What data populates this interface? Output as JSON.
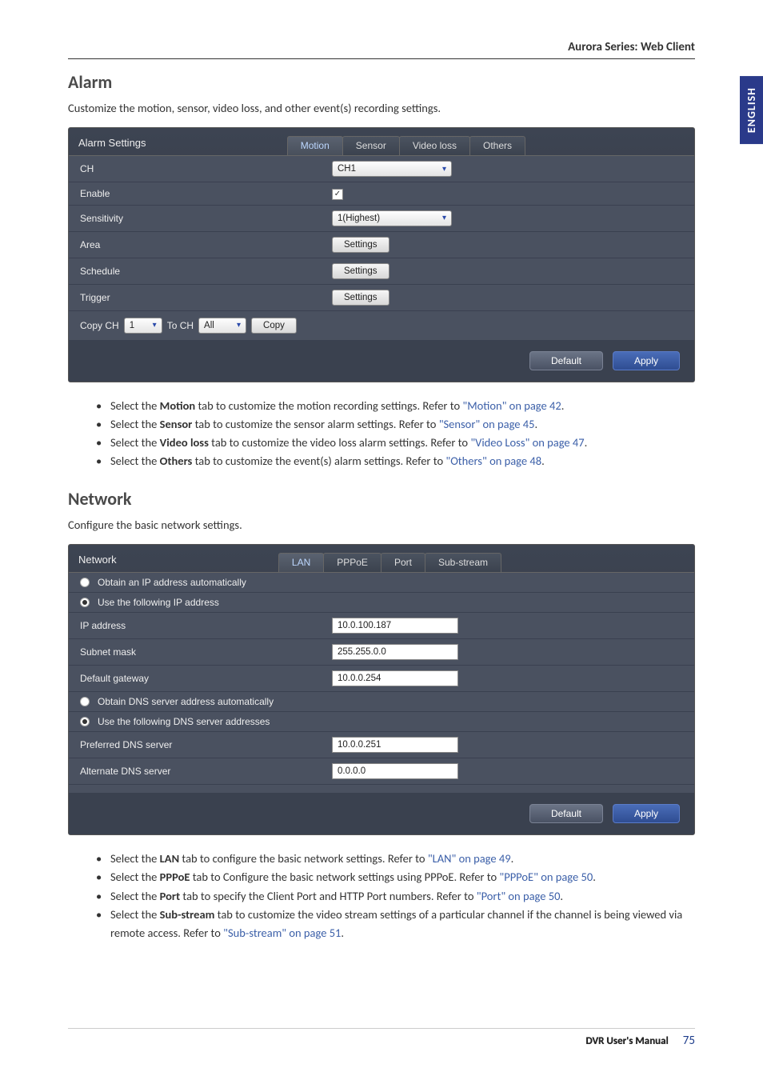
{
  "header": {
    "title": "Aurora Series: Web Client"
  },
  "side_tab": "ENGLISH",
  "alarm": {
    "heading": "Alarm",
    "intro": "Customize the motion, sensor, video loss, and other event(s) recording settings.",
    "panel_title": "Alarm Settings",
    "tabs": [
      "Motion",
      "Sensor",
      "Video loss",
      "Others"
    ],
    "rows": {
      "ch_label": "CH",
      "ch_value": "CH1",
      "enable_label": "Enable",
      "sensitivity_label": "Sensitivity",
      "sensitivity_value": "1(Highest)",
      "area_label": "Area",
      "area_btn": "Settings",
      "schedule_label": "Schedule",
      "schedule_btn": "Settings",
      "trigger_label": "Trigger",
      "trigger_btn": "Settings"
    },
    "copy": {
      "copy_ch_label": "Copy CH",
      "copy_ch_value": "1",
      "to_ch_label": "To CH",
      "to_ch_value": "All",
      "copy_btn": "Copy"
    },
    "footer": {
      "default_btn": "Default",
      "apply_btn": "Apply"
    },
    "bullets": [
      {
        "pre": "Select the ",
        "bold": "Motion",
        "post": " tab to customize the motion recording settings. Refer to ",
        "link": "\"Motion\" on page 42",
        "end": "."
      },
      {
        "pre": "Select the ",
        "bold": "Sensor",
        "post": " tab to customize the sensor alarm settings. Refer to ",
        "link": "\"Sensor\" on page 45",
        "end": "."
      },
      {
        "pre": "Select the ",
        "bold": "Video loss",
        "post": " tab to customize the video loss alarm settings. Refer to ",
        "link": "\"Video Loss\" on page 47",
        "end": "."
      },
      {
        "pre": "Select the ",
        "bold": "Others",
        "post": " tab to customize the event(s) alarm settings. Refer to ",
        "link": "\"Others\" on page 48",
        "end": "."
      }
    ]
  },
  "network": {
    "heading": "Network",
    "intro": "Configure the basic network settings.",
    "panel_title": "Network",
    "tabs": [
      "LAN",
      "PPPoE",
      "Port",
      "Sub-stream"
    ],
    "radios": {
      "obtain_ip": "Obtain an IP address automatically",
      "use_ip": "Use the following IP address",
      "obtain_dns": "Obtain DNS server address automatically",
      "use_dns": "Use the following DNS server addresses"
    },
    "fields": {
      "ip_label": "IP address",
      "ip_value": "10.0.100.187",
      "subnet_label": "Subnet mask",
      "subnet_value": "255.255.0.0",
      "gateway_label": "Default gateway",
      "gateway_value": "10.0.0.254",
      "pref_dns_label": "Preferred DNS server",
      "pref_dns_value": "10.0.0.251",
      "alt_dns_label": "Alternate DNS server",
      "alt_dns_value": "0.0.0.0"
    },
    "footer": {
      "default_btn": "Default",
      "apply_btn": "Apply"
    },
    "bullets": [
      {
        "pre": "Select the ",
        "bold": "LAN",
        "post": " tab to configure the basic network settings. Refer to ",
        "link": "\"LAN\" on page 49",
        "end": "."
      },
      {
        "pre": "Select the ",
        "bold": "PPPoE",
        "post": " tab to Configure the basic network settings using PPPoE. Refer to ",
        "link": "\"PPPoE\" on page 50",
        "end": "."
      },
      {
        "pre": "Select the ",
        "bold": "Port",
        "post": " tab to specify the Client Port and HTTP Port numbers. Refer to ",
        "link": "\"Port\" on page 50",
        "end": "."
      },
      {
        "pre": "Select the ",
        "bold": "Sub-stream",
        "post": " tab to customize the video stream settings of a particular channel if the channel is being viewed via remote access. Refer to ",
        "link": "\"Sub-stream\" on page 51",
        "end": "."
      }
    ]
  },
  "footer": {
    "manual": "DVR User's Manual",
    "page": "75"
  }
}
